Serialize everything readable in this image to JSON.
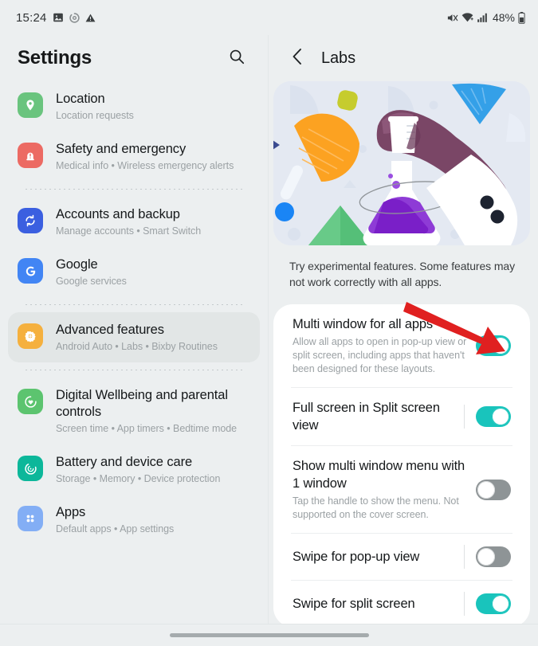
{
  "status_bar": {
    "time": "15:24",
    "left_icons": [
      "image-icon",
      "settings-spinner-icon",
      "warning-icon"
    ],
    "right_icons": [
      "mute-icon",
      "wifi-icon",
      "signal-icon"
    ],
    "battery": "48%"
  },
  "left_pane": {
    "title": "Settings",
    "search_icon": "search-icon",
    "items": [
      {
        "title": "Location",
        "subtitle": "Location requests",
        "icon": "location-pin-icon",
        "icon_color": "#6ac47e",
        "selected": false
      },
      {
        "title": "Safety and emergency",
        "subtitle": "Medical info  •  Wireless emergency alerts",
        "icon": "safety-emergency-icon",
        "icon_color": "#ec6a63",
        "selected": false
      },
      {
        "title": "Accounts and backup",
        "subtitle": "Manage accounts  •  Smart Switch",
        "icon": "sync-icon",
        "icon_color": "#3b5fe0",
        "selected": false
      },
      {
        "title": "Google",
        "subtitle": "Google services",
        "icon": "google-g-icon",
        "icon_color": "#4285f4",
        "selected": false
      },
      {
        "title": "Advanced features",
        "subtitle": "Android Auto  •  Labs  •  Bixby Routines",
        "icon": "gear-icon",
        "icon_color": "#f5b03e",
        "selected": true
      },
      {
        "title": "Digital Wellbeing and parental controls",
        "subtitle": "Screen time  •  App timers  •  Bedtime mode",
        "icon": "wellbeing-heart-icon",
        "icon_color": "#5cc46f",
        "selected": false
      },
      {
        "title": "Battery and device care",
        "subtitle": "Storage  •  Memory  •  Device protection",
        "icon": "device-care-icon",
        "icon_color": "#0cb79a",
        "selected": false
      },
      {
        "title": "Apps",
        "subtitle": "Default apps  •  App settings",
        "icon": "apps-grid-icon",
        "icon_color": "#83aef5",
        "selected": false
      }
    ]
  },
  "right_pane": {
    "back_icon": "back-chevron-icon",
    "title": "Labs",
    "banner_illustration": "lab-beaker-flask-illustration",
    "description": "Try experimental features. Some features may not work correctly with all apps.",
    "settings": [
      {
        "title": "Multi window for all apps",
        "subtitle": "Allow all apps to open in pop-up view or split screen, including apps that haven't been designed for these layouts.",
        "toggle": "on",
        "has_divider": false
      },
      {
        "title": "Full screen in Split screen view",
        "subtitle": "",
        "toggle": "on",
        "has_divider": true
      },
      {
        "title": "Show multi window menu with 1 window",
        "subtitle": "Tap the handle to show the menu. Not supported on the cover screen.",
        "toggle": "off",
        "has_divider": false
      },
      {
        "title": "Swipe for pop-up view",
        "subtitle": "",
        "toggle": "off",
        "has_divider": true
      },
      {
        "title": "Swipe for split screen",
        "subtitle": "",
        "toggle": "on",
        "has_divider": true
      }
    ]
  },
  "annotation": {
    "type": "red-arrow",
    "color": "#e02020",
    "points_to": "multi-window-for-all-apps-toggle"
  },
  "colors": {
    "background": "#eceff0",
    "card": "#ffffff",
    "toggle_on": "#19c4bc",
    "toggle_off": "#8e9496",
    "accent_red": "#e02020"
  },
  "nav_bar": {
    "gesture_pill": "home-gesture-pill"
  }
}
